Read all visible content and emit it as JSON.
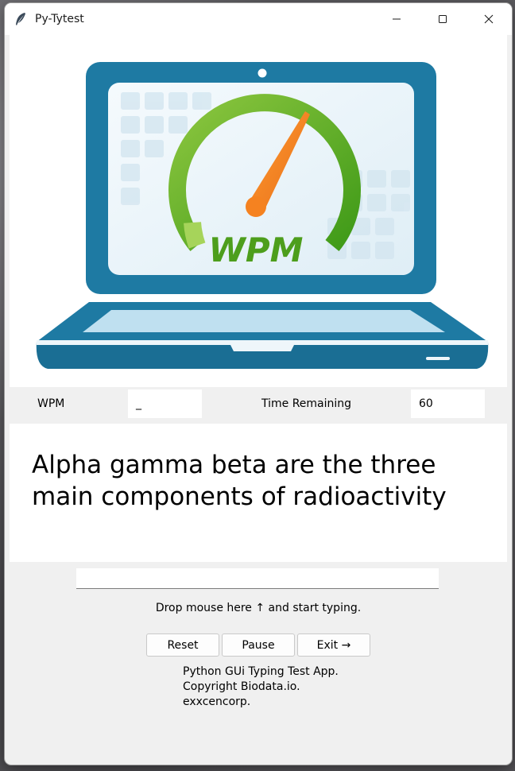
{
  "window": {
    "title": "Py-Tytest",
    "controls": [
      "minimize-icon",
      "maximize-icon",
      "close-icon"
    ]
  },
  "hero": {
    "logo_text": "WPM",
    "colors": {
      "laptop_blue": "#1e7aa3",
      "gauge_green": "#5aab1e",
      "needle_orange": "#f58220"
    }
  },
  "stats": {
    "wpm_label": "WPM",
    "wpm_value": "_",
    "time_label": "Time Remaining",
    "time_value": "60"
  },
  "sentence": "Alpha gamma beta are the three main components of radioactivity",
  "typing_input": {
    "value": ""
  },
  "hint": "Drop mouse here ↑ and start typing.",
  "buttons": {
    "reset": "Reset",
    "pause": "Pause",
    "exit": "Exit →"
  },
  "footer": {
    "line1": "Python GUi Typing Test App.",
    "line2": "Copyright Biodata.io.",
    "line3": "exxcencorp."
  }
}
